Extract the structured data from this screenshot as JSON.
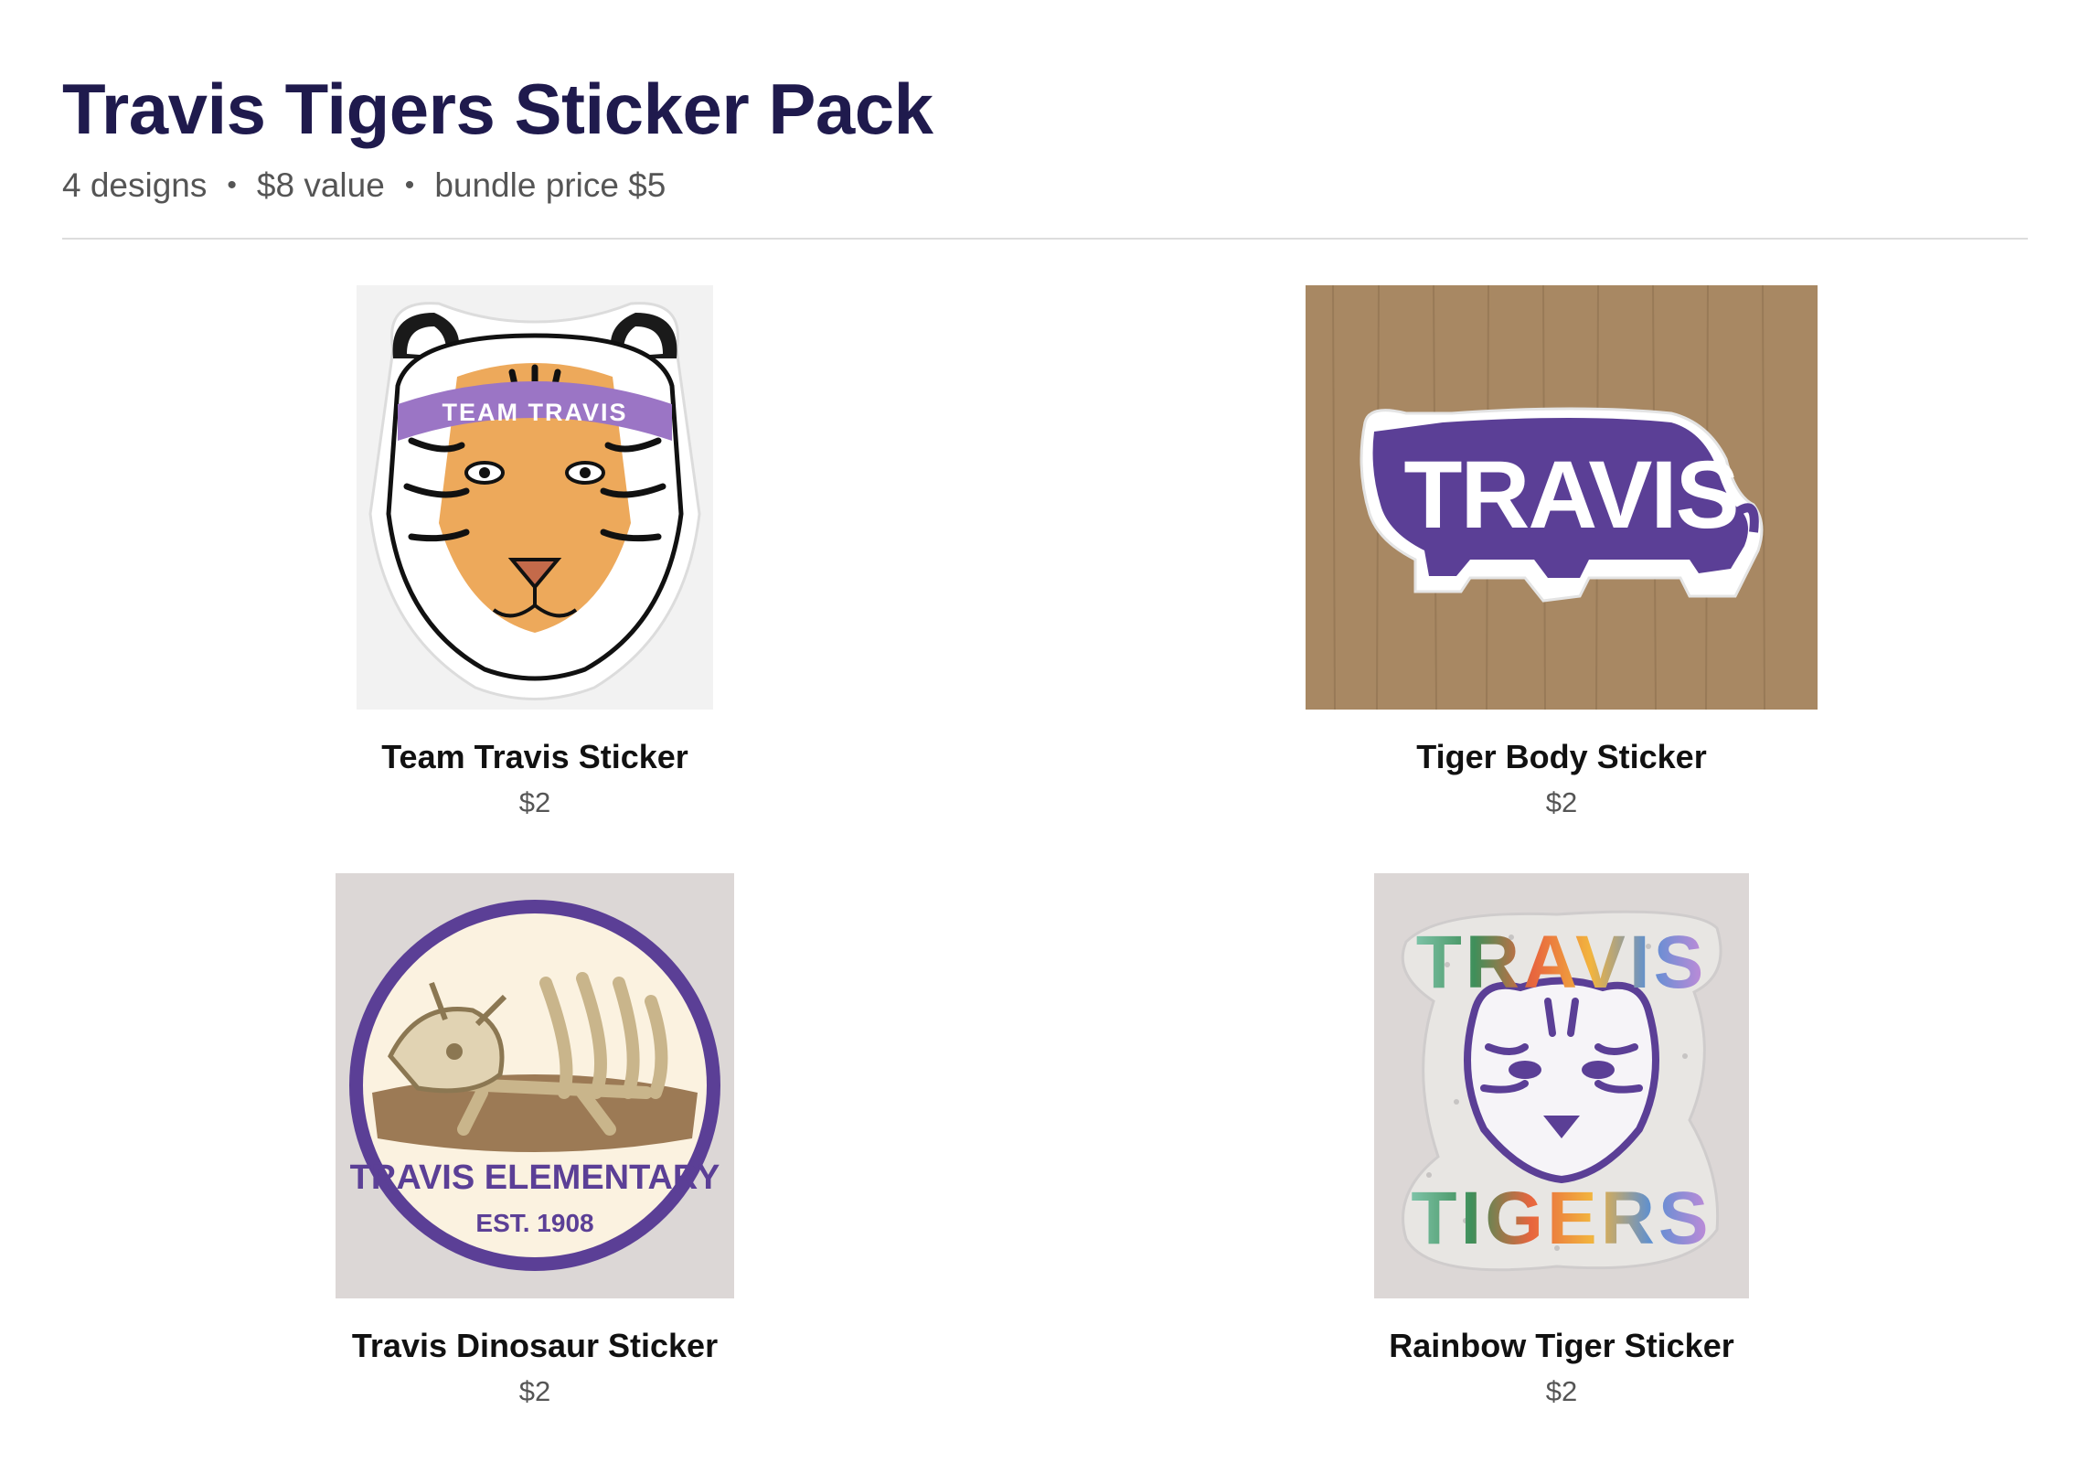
{
  "page": {
    "title": "Travis Tigers Sticker Pack",
    "meta": {
      "designs": "4 designs",
      "value": "$8 value",
      "bundle": "bundle price $5",
      "separator": "•"
    }
  },
  "stickers": [
    {
      "name": "Team Travis Sticker",
      "price": "$2",
      "art_text": "TEAM TRAVIS",
      "icon": "tiger-head-icon"
    },
    {
      "name": "Tiger Body Sticker",
      "price": "$2",
      "art_text": "TRAVIS",
      "icon": "tiger-body-icon"
    },
    {
      "name": "Travis Dinosaur Sticker",
      "price": "$2",
      "art_text": "TRAVIS ELEMENTARY",
      "art_subtext": "EST. 1908",
      "icon": "dinosaur-fossil-icon"
    },
    {
      "name": "Rainbow Tiger Sticker",
      "price": "$2",
      "art_text": "TRAVIS",
      "art_subtext": "TIGERS",
      "icon": "rainbow-tiger-icon"
    }
  ],
  "colors": {
    "title": "#1f1a4d",
    "purple": "#5b3f96",
    "orange": "#eda95b",
    "wood": "#a88863"
  }
}
